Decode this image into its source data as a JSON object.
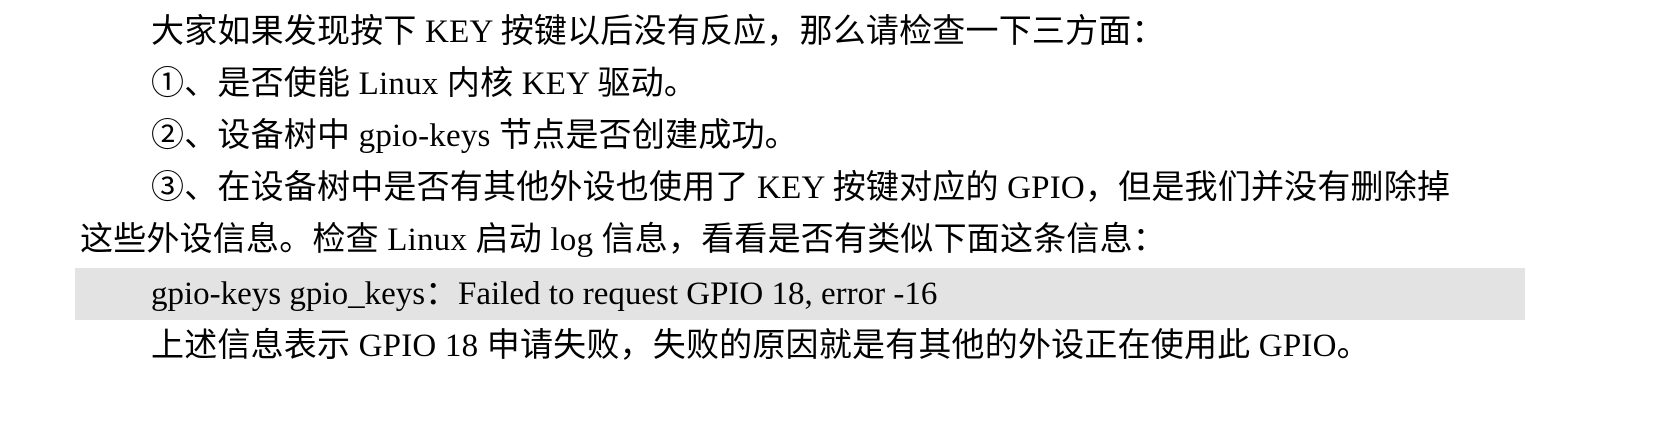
{
  "document": {
    "para_intro": "大家如果发现按下 KEY 按键以后没有反应，那么请检查一下三方面：",
    "item_1": "①、是否使能 Linux 内核 KEY 驱动。",
    "item_2": "②、设备树中 gpio-keys 节点是否创建成功。",
    "item_3_line1": "③、在设备树中是否有其他外设也使用了 KEY 按键对应的 GPIO，但是我们并没有删除掉",
    "item_3_line2": "这些外设信息。检查 Linux 启动 log 信息，看看是否有类似下面这条信息：",
    "log_message": "gpio-keys gpio_keys：Failed to request GPIO 18, error -16",
    "para_explanation": "上述信息表示 GPIO 18 申请失败，失败的原因就是有其他的外设正在使用此 GPIO。"
  }
}
